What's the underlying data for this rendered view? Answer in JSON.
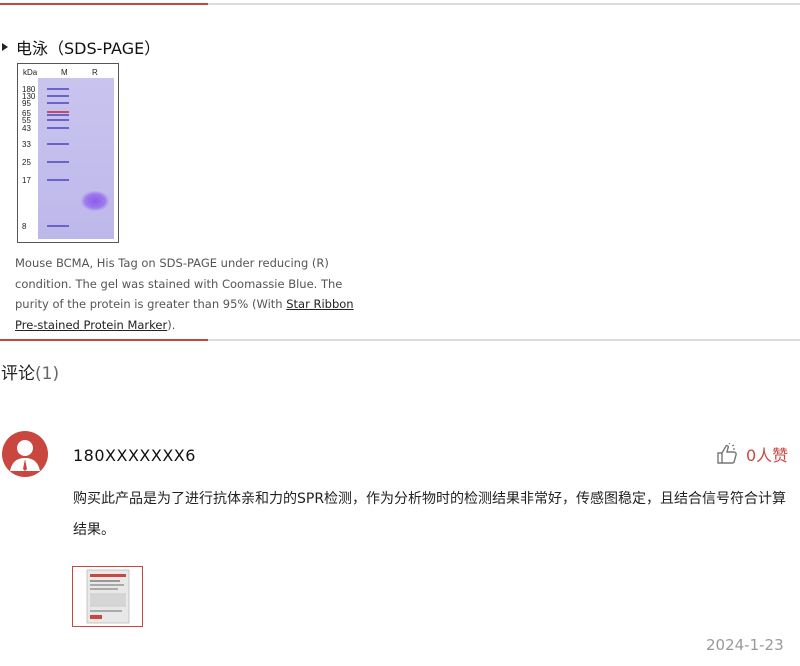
{
  "section": {
    "title": "电泳（SDS-PAGE）"
  },
  "gel": {
    "unit_label": "kDa",
    "lane_labels": [
      "M",
      "R"
    ],
    "markers": [
      "180",
      "130",
      "95",
      "65",
      "55",
      "43",
      "33",
      "25",
      "17",
      "8"
    ],
    "caption_text": "Mouse BCMA, His Tag on SDS-PAGE under reducing (R) condition. The gel was stained with Coomassie Blue. The purity of the protein is greater than 95% (With ",
    "caption_link": "Star Ribbon Pre-stained Protein Marker",
    "caption_end": ")."
  },
  "comments": {
    "title": "评论",
    "count": "(1)",
    "items": [
      {
        "user": "180XXXXXXX6",
        "likes": "0人赞",
        "text": "购买此产品是为了进行抗体亲和力的SPR检测，作为分析物时的检测结果非常好，传感图稳定，且结合信号符合计算结果。",
        "date": "2024-1-23"
      }
    ]
  },
  "colors": {
    "accent": "#c9473f",
    "divider": "#dcdcdc"
  }
}
